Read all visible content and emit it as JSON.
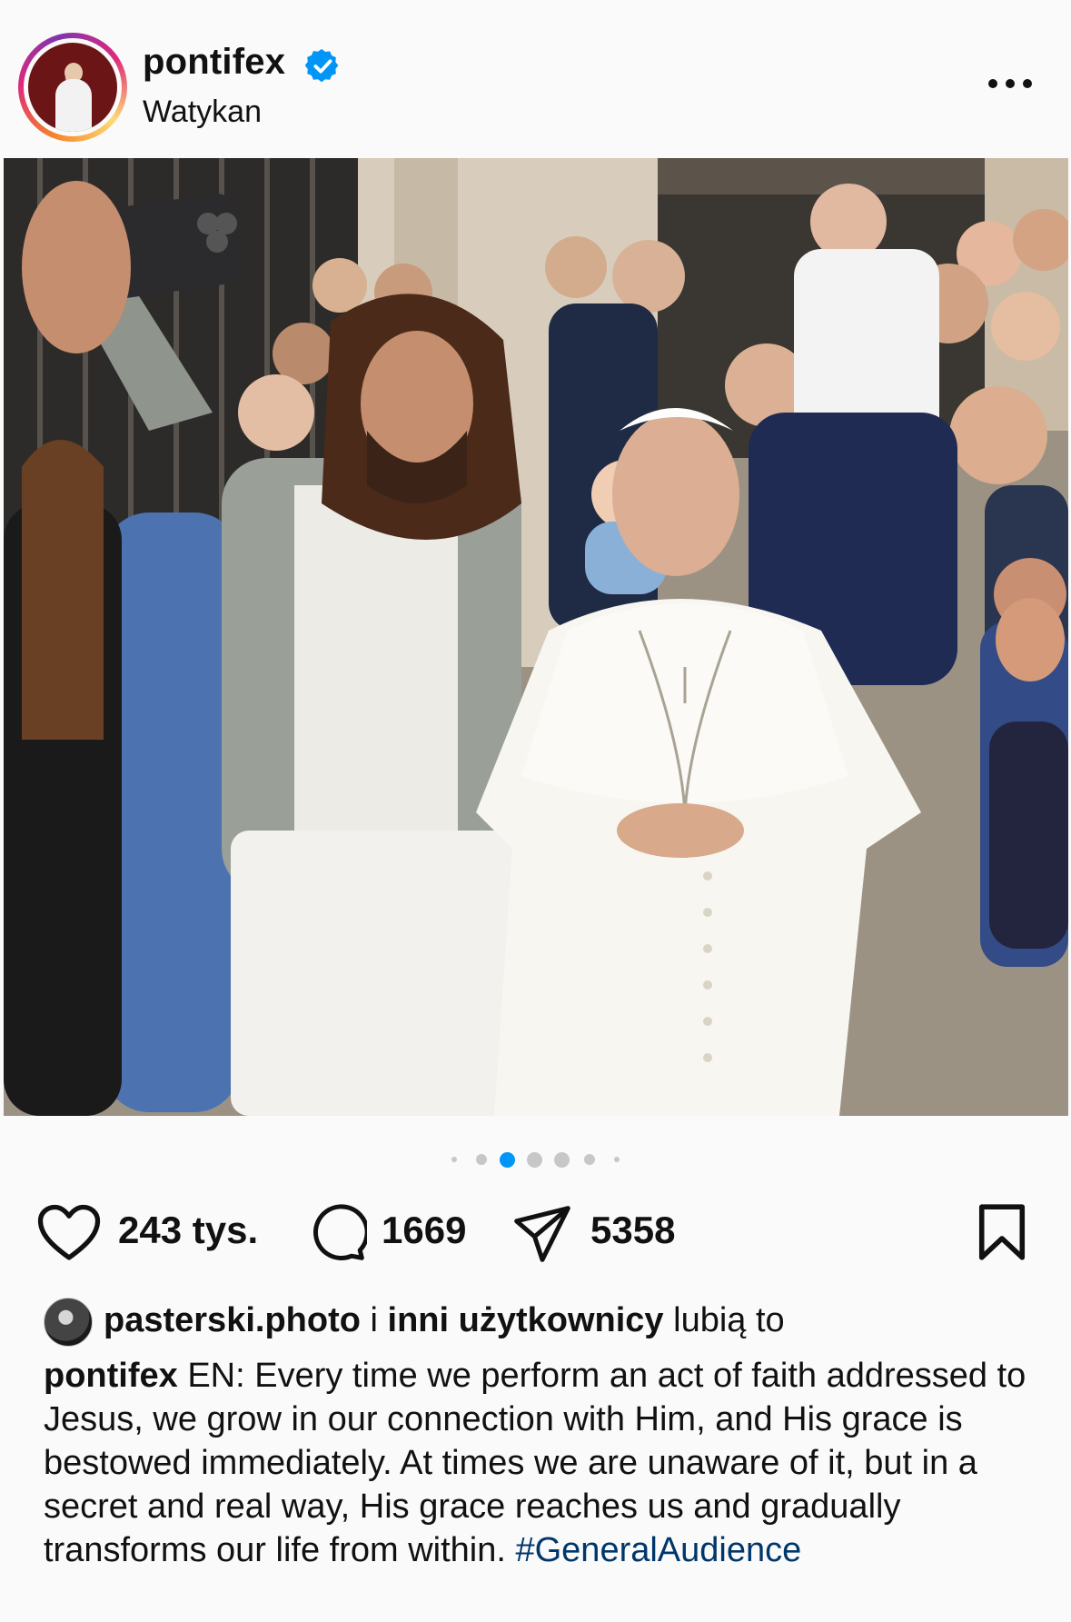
{
  "header": {
    "username": "pontifex",
    "location": "Watykan",
    "verified_icon": "verified-badge-icon",
    "more_icon": "more-horizontal-icon"
  },
  "post": {
    "image_alt": "Group selfie in front of a building with a man holding a phone next to a cleric in white vestments",
    "carousel": {
      "total": 7,
      "active_index": 2
    }
  },
  "actions": {
    "like_icon": "heart-icon",
    "like_count": "243 tys.",
    "comment_icon": "comment-icon",
    "comment_count": "1669",
    "share_icon": "send-icon",
    "share_count": "5358",
    "save_icon": "bookmark-icon"
  },
  "likes": {
    "user": "pasterski.photo",
    "connector": " i ",
    "others": "inni użytkownicy",
    "suffix": " lubią to"
  },
  "caption": {
    "author": "pontifex",
    "text": " EN: Every time we perform an act of faith addressed to Jesus, we grow in our connection with Him, and His grace is bestowed immediately. At times we are unaware of it, but in a secret and real way, His grace reaches us and gradually transforms our life from within. ",
    "hashtag": "#GeneralAudience"
  },
  "colors": {
    "accent": "#0095f6",
    "verified": "#0095f6",
    "hashtag": "#00376b",
    "background": "#fafafa"
  }
}
